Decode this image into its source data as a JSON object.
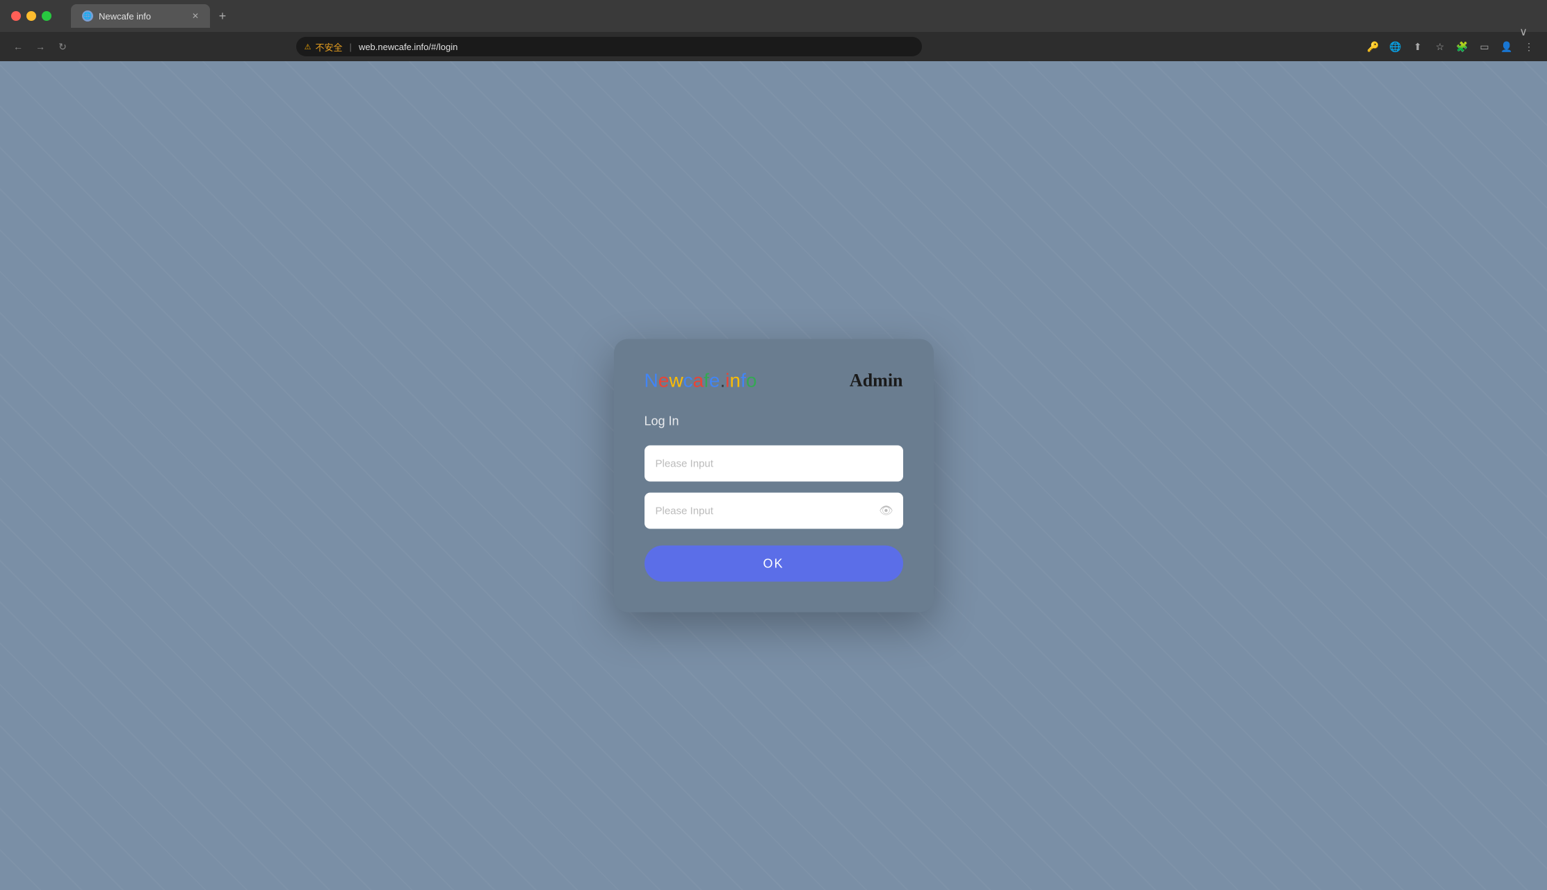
{
  "browser": {
    "tab": {
      "title": "Newcafe info",
      "favicon": "🌐"
    },
    "address": {
      "security_label": "不安全",
      "url": "web.newcafe.info/#/login"
    },
    "new_tab_label": "+",
    "scrollbar_indicator": "∨"
  },
  "page": {
    "logo": {
      "full_text": "Newcafe.info",
      "parts": [
        "N",
        "e",
        "w",
        "c",
        "a",
        "f",
        "e",
        ".",
        "i",
        "n",
        "f",
        "o"
      ]
    },
    "admin_label": "Admin",
    "form": {
      "title": "Log In",
      "username_placeholder": "Please Input",
      "password_placeholder": "Please Input",
      "ok_button_label": "OK"
    }
  }
}
